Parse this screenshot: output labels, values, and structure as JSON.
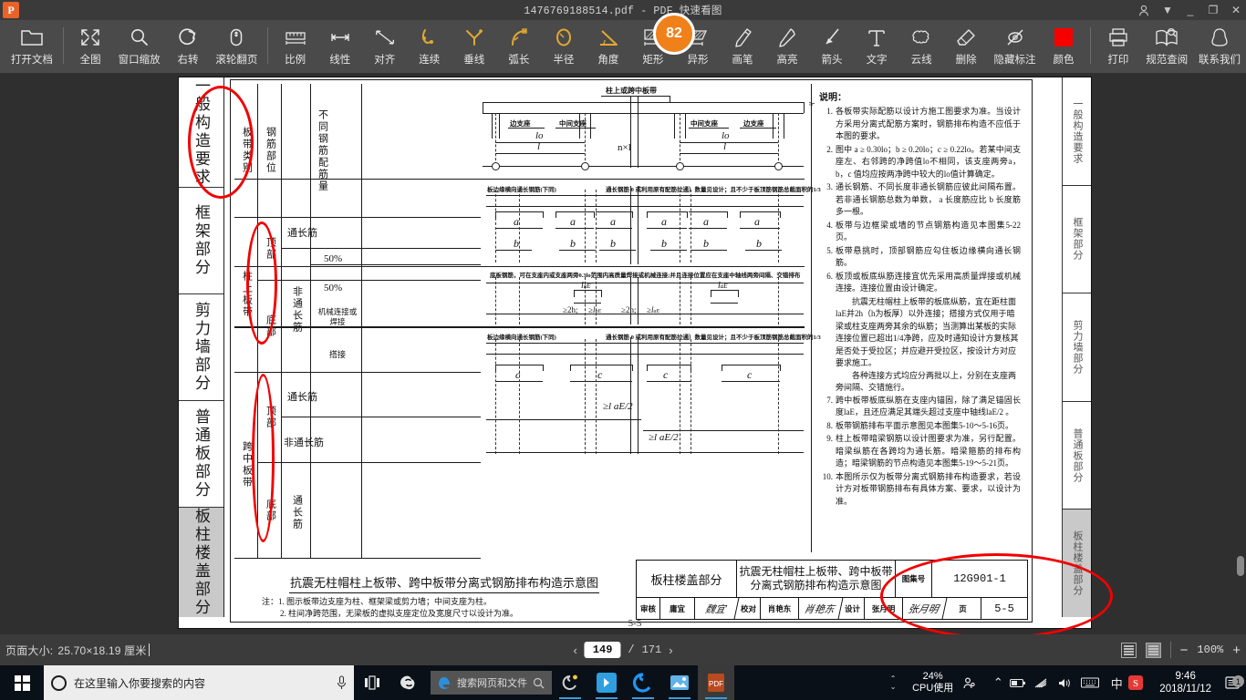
{
  "window": {
    "app_initial": "P",
    "title": "1476769188514.pdf - PDF 快速看图",
    "badge_count": "82",
    "controls": {
      "account": "account-icon",
      "menu": "▼",
      "minimize": "_",
      "maximize": "❐",
      "close": "✕"
    }
  },
  "toolbar": {
    "groups": [
      {
        "items": [
          {
            "icon": "open-folder-icon",
            "label": "打开文档"
          }
        ]
      },
      {
        "items": [
          {
            "icon": "fit-page-icon",
            "label": "全图"
          },
          {
            "icon": "zoom-window-icon",
            "label": "窗口缩放"
          },
          {
            "icon": "rotate-right-icon",
            "label": "右转"
          },
          {
            "icon": "mouse-scroll-icon",
            "label": "滚轮翻页"
          }
        ]
      },
      {
        "items": [
          {
            "icon": "scale-icon",
            "label": "比例"
          },
          {
            "icon": "linear-measure-icon",
            "label": "线性"
          },
          {
            "icon": "align-icon",
            "label": "对齐"
          },
          {
            "icon": "continuous-icon",
            "label": "连续"
          },
          {
            "icon": "perpendicular-icon",
            "label": "垂线"
          },
          {
            "icon": "arc-length-icon",
            "label": "弧长"
          },
          {
            "icon": "radius-icon",
            "label": "半径"
          },
          {
            "icon": "angle-icon",
            "label": "角度"
          },
          {
            "icon": "rectangle-icon",
            "label": "矩形"
          },
          {
            "icon": "polygon-icon",
            "label": "异形"
          },
          {
            "icon": "pen-icon",
            "label": "画笔"
          },
          {
            "icon": "highlighter-icon",
            "label": "高亮"
          },
          {
            "icon": "arrow-icon",
            "label": "箭头"
          },
          {
            "icon": "text-icon",
            "label": "文字"
          },
          {
            "icon": "cloud-icon",
            "label": "云线"
          },
          {
            "icon": "eraser-icon",
            "label": "删除"
          },
          {
            "icon": "hide-annotation-icon",
            "label": "隐藏标注"
          },
          {
            "icon": "color-swatch-icon",
            "label": "颜色",
            "color": "#f70000"
          }
        ]
      },
      {
        "items": [
          {
            "icon": "print-icon",
            "label": "打印"
          },
          {
            "icon": "book-search-icon",
            "label": "规范查阅"
          },
          {
            "icon": "qq-contact-icon",
            "label": "联系我们"
          }
        ]
      }
    ]
  },
  "document": {
    "left_index": [
      "一般构造要求",
      "框架部分",
      "剪力墙部分",
      "普通板部分",
      "板柱楼盖部分"
    ],
    "left_index_selected": "板柱楼盖部分",
    "right_index": [
      "一般构造要求",
      "框架部分",
      "剪力墙部分",
      "普通板部分",
      "板柱楼盖部分"
    ],
    "page_footer": "5-5",
    "table": {
      "header": [
        "板带类别",
        "钢筋部位",
        "不同钢筋配筋量"
      ],
      "groups": [
        {
          "category": "柱上板带",
          "rows": [
            {
              "part": "顶部",
              "kind": "非通长筋",
              "qty": [
                "50%",
                "50%"
              ]
            },
            {
              "part": "底部",
              "kind": "通长筋",
              "qty": [
                "机械连接或焊接",
                "搭接"
              ]
            }
          ]
        },
        {
          "category": "跨中板带",
          "rows": [
            {
              "part": "顶部",
              "kind1": "通长筋",
              "kind2": "非通长筋"
            },
            {
              "part": "底部",
              "kind": "通长筋"
            }
          ]
        }
      ]
    },
    "drawing": {
      "top_label": "柱上或跨中板带",
      "support_edge": "边支座",
      "support_mid": "中间支座",
      "dim_lo": "lo",
      "dim_l": "l",
      "dim_nl": "n×l",
      "dim_h": "h",
      "ann_slab_edge": "板边缘横向通长钢筋(下同)",
      "ann_through": "通长钢筋 0 或利用原有配筋拉通）数量见设计；且不少于板顶筋钢筋总截面积的1/3",
      "ann_bottom_lap": "底板钢筋，可在支座内或支座两旁0.3lo范围内高质量焊接或机械连接;并且连接位置应在支座中轴线两旁间隔、交错排布",
      "label_a": "a",
      "label_b": "b",
      "label_c": "c",
      "lae": "l",
      "lae_sub": "aE",
      "ge2h": "≥2h;",
      "ge_lae": "≥l",
      "ge_lae_half": "≥l aE/2"
    },
    "notes": {
      "title": "说明：",
      "items": [
        {
          "num": "1.",
          "text": "各板带实际配筋以设计方施工图要求为准。当设计方采用分离式配筋方案时，钢筋排布构造不应低于本图的要求。"
        },
        {
          "num": "2.",
          "text": "图中 a ≥ 0.30lo；b ≥ 0.20lo；c ≥ 0.22lo。若某中间支座左、右邻跨的净跨值lo不相同，该支座两旁a，b，c 值均应按两净跨中较大的lo值计算确定。"
        },
        {
          "num": "3.",
          "text": "通长钢筋、不同长度非通长钢筋应彼此间隔布置。若非通长钢筋总数为单数， a 长度筋应比 b 长度筋多一根。"
        },
        {
          "num": "4.",
          "text": "板带与边框梁或墙的节点钢筋构造见本图集5-22页。"
        },
        {
          "num": "5.",
          "text": "板带悬挑时，顶部钢筋应勾住板边缘横向通长钢筋。"
        },
        {
          "num": "6.",
          "text": "板顶或板底纵筋连接宜优先采用高质量焊接或机械连接。连接位置由设计确定。"
        }
      ],
      "paragraph1": "抗震无柱帽柱上板带的板底纵筋，宜在距柱面laE并2h（h为板厚）以外连接；搭接方式仅用于暗梁或柱支座两旁其余的纵筋；当测算出某板的实际连接位置已超出1/4净跨，应及时通知设计方复核其是否处于受拉区；并应避开受拉区，按设计方对应要求施工。",
      "paragraph2": "各种连接方式均应分两批以上，分别在支座两旁间隔、交错施行。",
      "items2": [
        {
          "num": "7.",
          "text": "跨中板带板底纵筋在支座内锚固，除了满足锚固长度laE，且还应满足其端头超过支座中轴线laE/2 。"
        },
        {
          "num": "8.",
          "text": "板带钢筋排布平面示意图见本图集5-10～5-16页。"
        },
        {
          "num": "9.",
          "text": "柱上板带暗梁钢筋以设计图要求为准，另行配置。暗梁纵筋在各跨均为通长筋。暗梁箍筋的排布构造；暗梁钢筋的节点构造见本图集5-19～5-21页。"
        },
        {
          "num": "10.",
          "text": "本图所示仅为板带分离式钢筋排布构造要求，若设计方对板带钢筋排布有具体方案、要求，以设计为准。"
        }
      ]
    },
    "caption": {
      "title": "抗震无柱帽柱上板带、跨中板带分离式钢筋排布构造示意图",
      "note_label": "注：",
      "note1": "1. 图示板带边支座为柱、框架梁或剪力墙；中间支座为柱。",
      "note2": "2. 柱间净跨范围，无梁板的虚拟支座定位及宽度尺寸以设计为准。"
    },
    "title_block": {
      "section": "板柱楼盖部分",
      "drawing_name_line1": "抗震无柱帽柱上板带、跨中板带",
      "drawing_name_line2": "分离式钢筋排布构造示意图",
      "atlas_no_label": "图集号",
      "atlas_no_value": "12G901-1",
      "page_label": "页",
      "page_value": "5-5",
      "review_label": "审核",
      "review_name": "庸宜",
      "review_sign": "魏宜",
      "check_label": "校对",
      "check_name": "肖艳东",
      "check_sign": "肖艳东",
      "design_label": "设计",
      "design_name": "张月明",
      "design_sign": "张月明"
    }
  },
  "status_bar": {
    "page_size_label": "页面大小:",
    "page_size_value": "25.70×18.19 厘米",
    "prev_arrow": "‹",
    "current_page": "149",
    "page_separator": "/",
    "total_pages": "171",
    "next_arrow": "›",
    "zoom_out": "−",
    "zoom_level": "100%",
    "zoom_in": "+"
  },
  "taskbar": {
    "start": "windows-start-icon",
    "search_placeholder": "在这里输入你要搜索的内容",
    "mic": "microphone-icon",
    "task_view": "task-view-icon",
    "apps": [
      "skype-icon",
      "edge-icon",
      "quick-access-icon",
      "cloud-icon",
      "photos-icon",
      "pdf-reader-icon"
    ],
    "ie_search_placeholder": "搜索网页和文件",
    "cpu_percent": "24%",
    "cpu_label": "CPU使用",
    "ime": "中",
    "time": "9:46",
    "date": "2018/11/12",
    "notification_count": "1"
  }
}
